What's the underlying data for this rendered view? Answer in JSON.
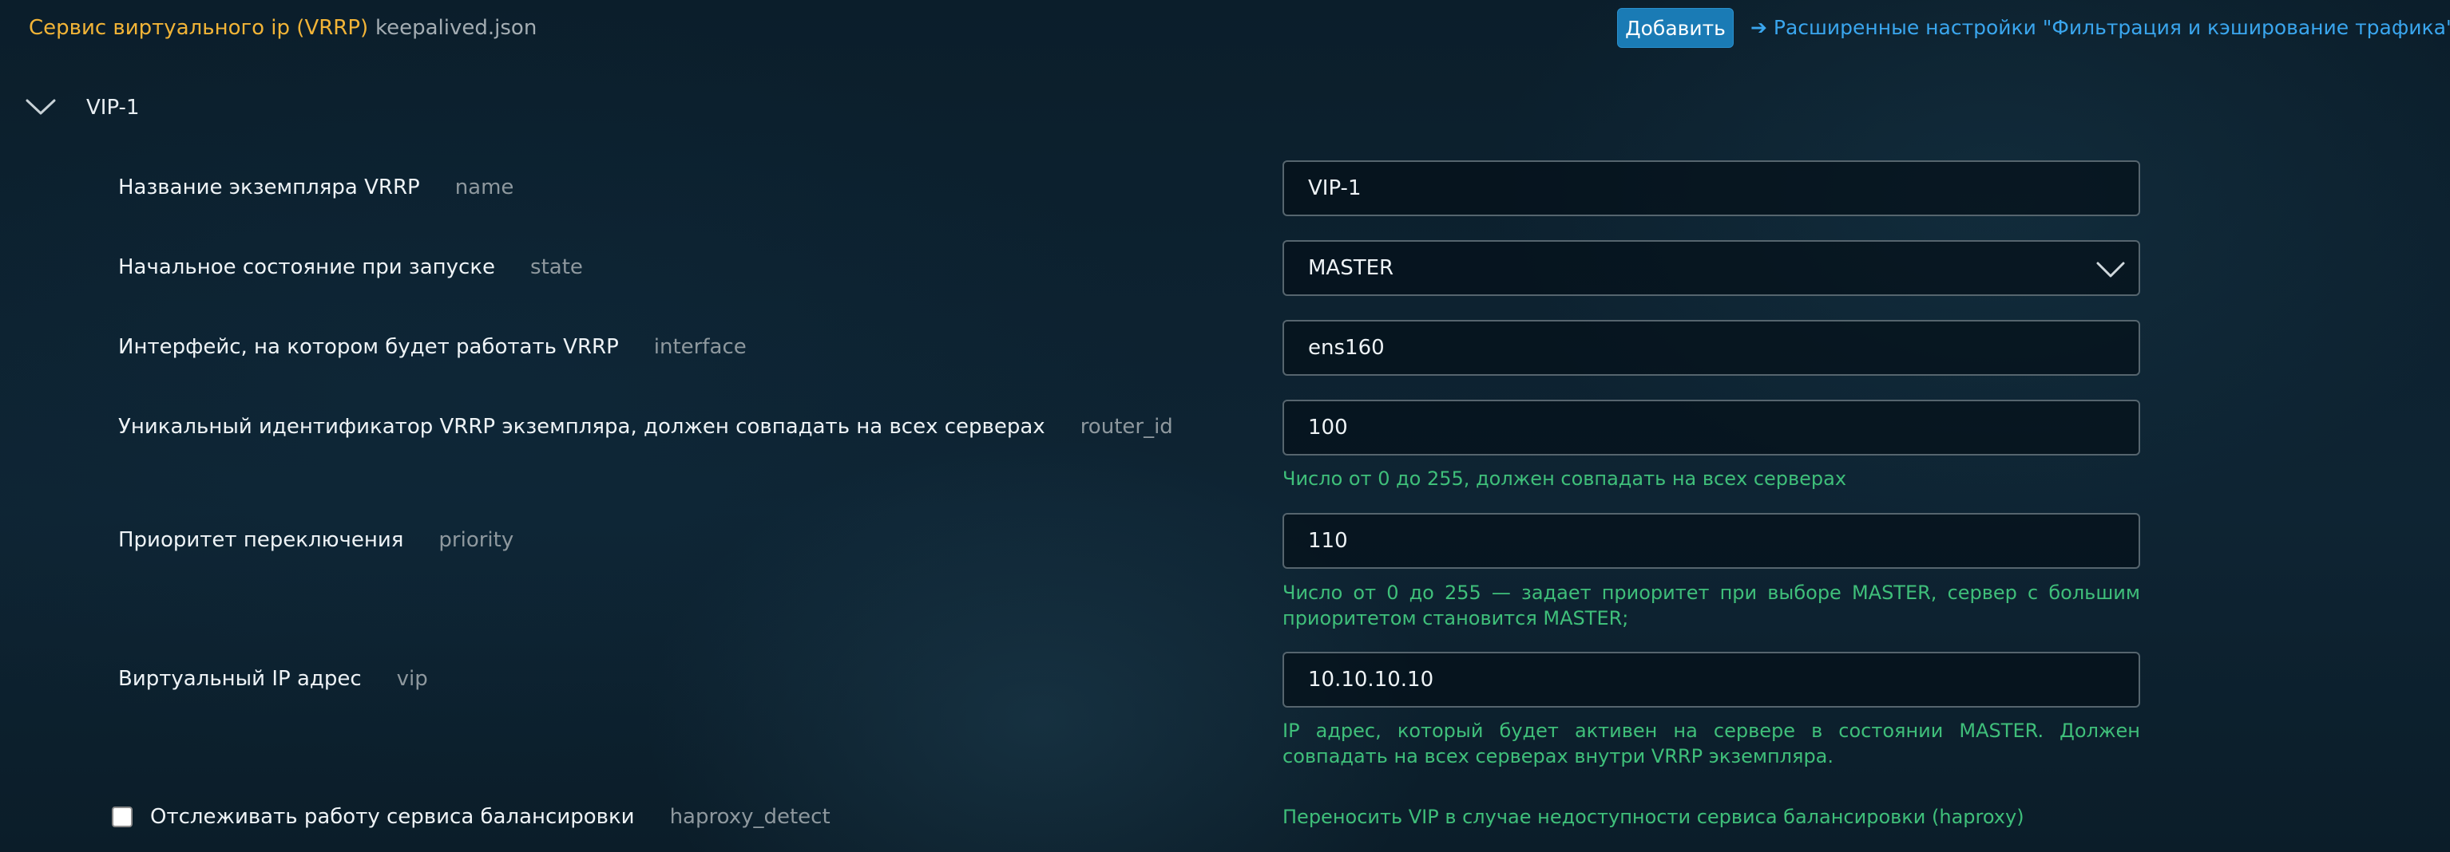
{
  "header": {
    "title": "Сервис виртуального ip (VRRP)",
    "file": "keepalived.json",
    "add_button": "Добавить",
    "advanced_link": "➔ Расширенные настройки \"Фильтрация и кэширование трафика\""
  },
  "section": {
    "title": "VIP-1",
    "expanded": true
  },
  "fields": {
    "name": {
      "label": "Название экземпляра VRRP",
      "key": "name",
      "value": "VIP-1"
    },
    "state": {
      "label": "Начальное состояние при запуске",
      "key": "state",
      "value": "MASTER"
    },
    "interface": {
      "label": "Интерфейс, на котором будет работать VRRP",
      "key": "interface",
      "value": "ens160"
    },
    "router_id": {
      "label": "Уникальный идентификатор VRRP экземпляра, должен совпадать на всех серверах",
      "key": "router_id",
      "value": "100",
      "hint": "Число от 0 до 255, должен совпадать на всех серверах"
    },
    "priority": {
      "label": "Приоритет переключения",
      "key": "priority",
      "value": "110",
      "hint": "Число от 0 до 255 — задает приоритет при выборе MASTER, сервер с большим приоритетом становится MASTER;"
    },
    "vip": {
      "label": "Виртуальный IP адрес",
      "key": "vip",
      "value": "10.10.10.10",
      "hint": "IP адрес, который будет активен на сервере в состоянии MASTER. Должен совпадать на всех серверах внутри VRRP экземпляра."
    },
    "haproxy_detect": {
      "label": "Отслеживать работу сервиса балансировки",
      "key": "haproxy_detect",
      "checked": false,
      "hint": "Переносить VIP в случае недоступности сервиса балансировки (haproxy)"
    }
  },
  "colors": {
    "accent_title": "#f2b437",
    "link": "#3aa6ee",
    "button": "#1a7bb5",
    "hint": "#3fbf7a",
    "background": "#0c1f2c"
  }
}
